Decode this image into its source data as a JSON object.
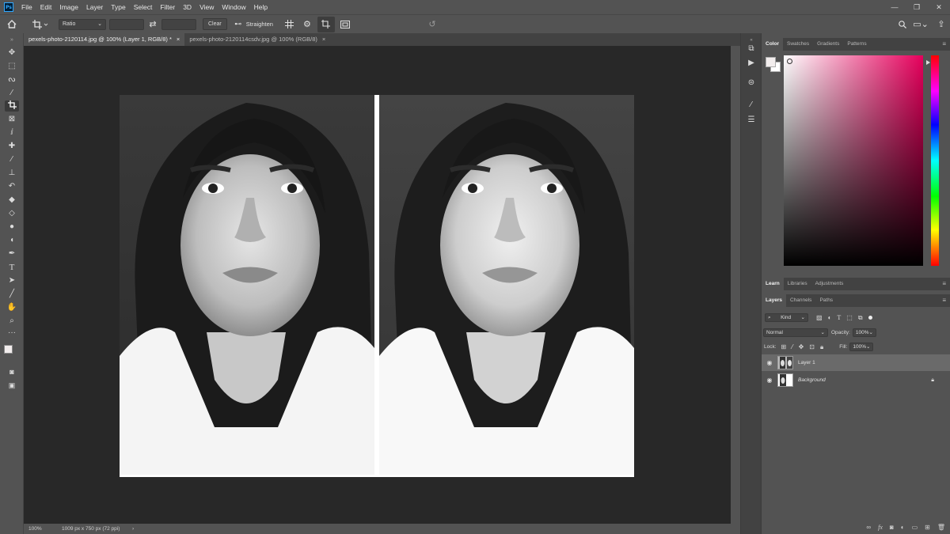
{
  "app": {
    "logo_text": "Ps",
    "accent": "#31a8ff"
  },
  "menu": [
    "File",
    "Edit",
    "Image",
    "Layer",
    "Type",
    "Select",
    "Filter",
    "3D",
    "View",
    "Window",
    "Help"
  ],
  "window_controls": [
    "—",
    "❐",
    "✕"
  ],
  "options": {
    "ratio_value": "Ratio",
    "width_value": "",
    "height_value": "",
    "clear_label": "Clear",
    "straighten_label": "Straighten"
  },
  "tabs": [
    {
      "label": "pexels-photo-2120114.jpg @ 100% (Layer 1, RGB/8) *",
      "close": "×"
    },
    {
      "label": "pexels-photo-2120114csdv.jpg @ 100% (RGB/8)",
      "close": "×"
    }
  ],
  "status": {
    "zoom": "100%",
    "doc_info": "1009 px x 750 px (72 ppi)",
    "arrow": "›"
  },
  "color_panel": {
    "tabs": [
      "Color",
      "Swatches",
      "Gradients",
      "Patterns"
    ],
    "hue_color": "#e6005c",
    "foreground": "#f2eded",
    "background": "#ffffff"
  },
  "learn_panel": {
    "tabs": [
      "Learn",
      "Libraries",
      "Adjustments"
    ]
  },
  "layers_panel": {
    "tabs": [
      "Layers",
      "Channels",
      "Paths"
    ],
    "filter_kind": "Kind",
    "blend_mode": "Normal",
    "opacity_label": "Opacity:",
    "opacity_value": "100%",
    "lock_label": "Lock:",
    "fill_label": "Fill:",
    "fill_value": "100%",
    "layers": [
      {
        "name": "Layer 1",
        "selected": true
      },
      {
        "name": "Background",
        "selected": false,
        "locked": true
      }
    ]
  }
}
